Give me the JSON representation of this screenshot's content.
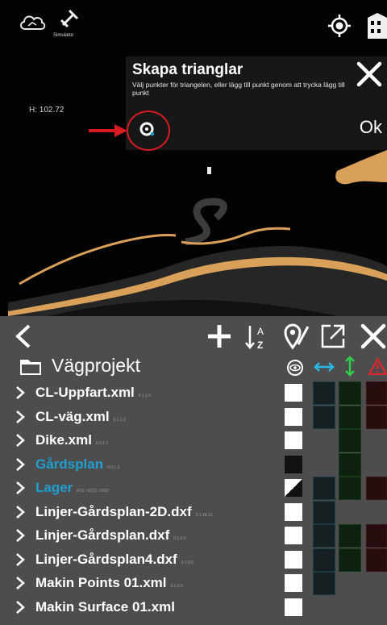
{
  "status": {
    "simulator_label": "Simulator",
    "height_label": "H: 102.72"
  },
  "dialog": {
    "title": "Skapa trianglar",
    "text": "Välj punkter för triangelen, eller lägg till punkt genom att trycka lägg till punkt",
    "ok_label": "Ok"
  },
  "panel": {
    "project_name": "Vägprojekt",
    "layers": [
      {
        "name": "CL-Uppfart.xml",
        "meta": "0.1.1.0",
        "color": "white",
        "checkbox": "checked",
        "cells": [
          true,
          true,
          true
        ]
      },
      {
        "name": "CL-väg.xml",
        "meta": "0.1.1.0",
        "color": "white",
        "checkbox": "checked",
        "cells": [
          true,
          true,
          true
        ]
      },
      {
        "name": "Dike.xml",
        "meta": "0.0.1.1",
        "color": "white",
        "checkbox": "checked",
        "cells": [
          false,
          true,
          false
        ]
      },
      {
        "name": "Gårdsplan",
        "meta": "0.0.1.3",
        "color": "blue",
        "checkbox": "unchecked",
        "cells": [
          false,
          true,
          false
        ]
      },
      {
        "name": "Lager",
        "meta": "R12 / 2021 / 2022",
        "color": "blue",
        "checkbox": "partial",
        "cells": [
          true,
          true,
          true
        ]
      },
      {
        "name": "Linjer-Gårdsplan-2D.dxf",
        "meta": "0.1.18.13",
        "color": "white",
        "checkbox": "checked",
        "cells": [
          true,
          false,
          false
        ]
      },
      {
        "name": "Linjer-Gårdsplan.dxf",
        "meta": "0.1.0.0",
        "color": "white",
        "checkbox": "checked",
        "cells": [
          true,
          true,
          true
        ]
      },
      {
        "name": "Linjer-Gårdsplan4.dxf",
        "meta": "0.1.0.0",
        "color": "white",
        "checkbox": "checked",
        "cells": [
          true,
          true,
          true
        ]
      },
      {
        "name": "Makin Points 01.xml",
        "meta": "0.1.1.0",
        "color": "white",
        "checkbox": "checked",
        "cells": [
          true,
          false,
          false
        ]
      },
      {
        "name": "Makin Surface 01.xml",
        "meta": "",
        "color": "white",
        "checkbox": "checked",
        "cells": [
          false,
          false,
          false
        ]
      }
    ]
  },
  "colors": {
    "accent_blue": "#1e9fcf",
    "highlight_red": "#d91a22",
    "road_orange": "#d9a05a",
    "visibility_cyan": "#2bb8e8",
    "elevation_green": "#2fcf4a",
    "warning_red": "#e0262a"
  },
  "icons": [
    "cloud-icon",
    "satellite-icon",
    "gps-target-icon",
    "building-icon",
    "close-icon",
    "point-icon",
    "back-arrow-icon",
    "add-icon",
    "sort-az-icon",
    "map-pin-icon",
    "open-external-icon",
    "folder-icon",
    "eye-icon",
    "horizontal-arrows-icon",
    "vertical-arrows-icon",
    "warning-icon",
    "chevron-right-icon"
  ]
}
